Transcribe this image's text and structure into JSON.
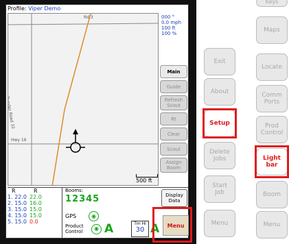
{
  "device": {
    "profile_label": "Profile:",
    "profile_name": "Viper Demo",
    "readouts": [
      "000 °",
      "0.0 mph",
      "100 ft",
      "100 %"
    ],
    "road_labels": [
      "Rd 3",
      "Bunder Road 32",
      "Hwy 16"
    ],
    "side_buttons": [
      "Main",
      "Guide",
      "Refresh\nScout",
      "Rt",
      "Clear",
      "Scout",
      "Assign\nBoom"
    ],
    "scale_label": "500 ft",
    "rates": {
      "col1_header": "R",
      "col2_header": "R",
      "rows": [
        {
          "id": "1.",
          "r1": "22.0",
          "r2": "22.0",
          "red": false
        },
        {
          "id": "2.",
          "r1": "15.0",
          "r2": "16.0",
          "red": false
        },
        {
          "id": "3.",
          "r1": "15.0",
          "r2": "15.0",
          "red": false
        },
        {
          "id": "4.",
          "r1": "15.0",
          "r2": "15.0",
          "red": false
        },
        {
          "id": "5.",
          "r1": "15.0",
          "r2": "0.0",
          "red": true
        }
      ]
    },
    "booms_label": "Booms:",
    "booms_value": "12345",
    "gps_label": "GPS",
    "product_control_label": "Product\nControl",
    "time_label": "Tm Hi",
    "time_value": "30",
    "display_data_label": "Display\nData",
    "menu_label": "Menu"
  },
  "middle_column": {
    "buttons": [
      {
        "label": "Exit",
        "active": false
      },
      {
        "label": "About",
        "active": false
      },
      {
        "label": "Setup",
        "active": true
      },
      {
        "label": "Delete\nJobs",
        "active": false
      },
      {
        "label": "Start\nJob",
        "active": false
      },
      {
        "label": "Menu",
        "active": false
      }
    ]
  },
  "right_column": {
    "top_label": "Keys",
    "buttons": [
      {
        "label": "Maps",
        "active": false
      },
      {
        "label": "Locate",
        "active": false
      },
      {
        "label": "Comm\nPorts",
        "active": false
      },
      {
        "label": "Prod\nControl",
        "active": false
      },
      {
        "label": "Light\nbar",
        "active": true
      },
      {
        "label": "Boom",
        "active": false
      },
      {
        "label": "Menu",
        "active": false
      }
    ]
  },
  "colors": {
    "accent_red": "#e01a1a",
    "green": "#1aa31a",
    "blue": "#1b3fb8",
    "route_orange": "#e08a2a"
  }
}
